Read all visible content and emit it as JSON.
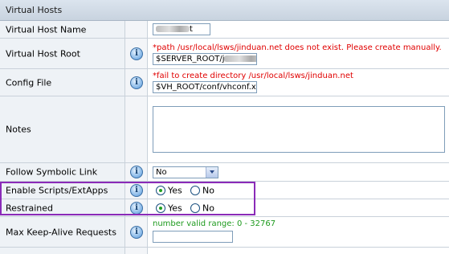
{
  "section": {
    "title": "Virtual Hosts"
  },
  "rows": {
    "name": {
      "label": "Virtual Host Name",
      "value": "t"
    },
    "root": {
      "label": "Virtual Host Root",
      "error": "*path /usr/local/lsws/jinduan.net does not exist. Please create manually.",
      "value": "$SERVER_ROOT/j"
    },
    "config": {
      "label": "Config File",
      "error": "*fail to create directory /usr/local/lsws/jinduan.net",
      "value": "$VH_ROOT/conf/vhconf.xml"
    },
    "notes": {
      "label": "Notes",
      "value": ""
    },
    "symlink": {
      "label": "Follow Symbolic Link",
      "value": "No"
    },
    "scripts": {
      "label": "Enable Scripts/ExtApps",
      "yes": "Yes",
      "no": "No",
      "selected": "Yes"
    },
    "restrained": {
      "label": "Restrained",
      "yes": "Yes",
      "no": "No",
      "selected": "Yes"
    },
    "keepalive": {
      "label": "Max Keep-Alive Requests",
      "hint": "number valid range: 0 - 32767",
      "value": ""
    }
  },
  "colors": {
    "highlight": "#8a2bb8",
    "error": "#e00000",
    "hint": "#1e9a1e",
    "header_bg": "#c8d3df"
  }
}
